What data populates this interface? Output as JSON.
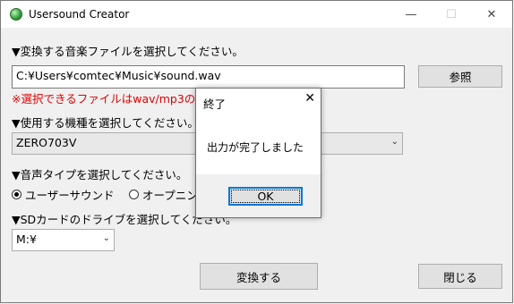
{
  "window": {
    "title": "Usersound Creator",
    "icons": {
      "app": "app-icon",
      "minimize": "minimize-icon",
      "maximize": "maximize-icon",
      "close": "close-icon"
    }
  },
  "file_section": {
    "label": "▼変換する音楽ファイルを選択してください。",
    "path_value": "C:¥Users¥comtec¥Music¥sound.wav",
    "browse_label": "参照",
    "warning": "※選択できるファイルはwav/mp3のみ"
  },
  "model_section": {
    "label": "▼使用する機種を選択してください。",
    "selected": "ZERO703V"
  },
  "voice_section": {
    "label": "▼音声タイプを選択してください。",
    "options": [
      {
        "label": "ユーザーサウンド",
        "checked": true
      },
      {
        "label": "オープニング",
        "checked": false
      }
    ]
  },
  "sd_section": {
    "label": "▼SDカードのドライブを選択してください。",
    "selected": "M:¥"
  },
  "actions": {
    "convert_label": "変換する",
    "close_label": "閉じる"
  },
  "dialog": {
    "title": "終了",
    "message": "出力が完了しました",
    "ok_label": "OK"
  }
}
